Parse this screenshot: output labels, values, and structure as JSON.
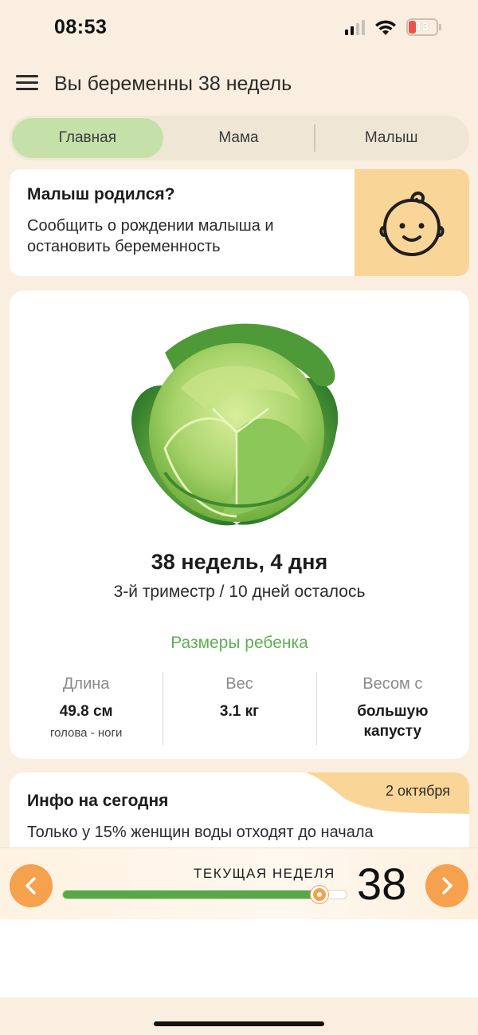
{
  "status_bar": {
    "time": "08:53",
    "battery_level": "13",
    "icons": [
      "signal-icon",
      "wifi-icon",
      "battery-icon"
    ]
  },
  "header": {
    "title": "Вы беременны 38 недель",
    "menu_icon": "hamburger-menu-icon"
  },
  "tabs": [
    {
      "label": "Главная",
      "active": true
    },
    {
      "label": "Мама",
      "active": false
    },
    {
      "label": "Малыш",
      "active": false
    }
  ],
  "born_card": {
    "title": "Малыш родился?",
    "description": "Сообщить о рождении малыша и остановить беременность",
    "icon": "baby-face-icon",
    "bg_color": "#f9d597"
  },
  "week_card": {
    "image": "cabbage-illustration",
    "week_count": "38 недель, 4 дня",
    "trimester_info": "3-й триместр / 10 дней осталось",
    "sizes_title": "Размеры ребенка",
    "sizes": [
      {
        "label": "Длина",
        "value": "49.8 см",
        "note": "голова - ноги"
      },
      {
        "label": "Вес",
        "value": "3.1 кг",
        "note": ""
      },
      {
        "label": "Весом с",
        "value": "большую капусту",
        "note": ""
      }
    ]
  },
  "info_card": {
    "title": "Инфо на сегодня",
    "date": "2 октября",
    "text": "Только у 15% женщин воды отходят до начала"
  },
  "week_bar": {
    "label": "ТЕКУЩАЯ НЕДЕЛЯ",
    "week_number": "38",
    "progress": 0.905,
    "prev_icon": "chevron-left-icon",
    "next_icon": "chevron-right-icon"
  },
  "colors": {
    "background": "#f9eedf",
    "accent_green": "#56a947",
    "active_tab": "#c5e1a9",
    "accent_orange": "#f6a14e",
    "sizes_title": "#5fb055"
  }
}
